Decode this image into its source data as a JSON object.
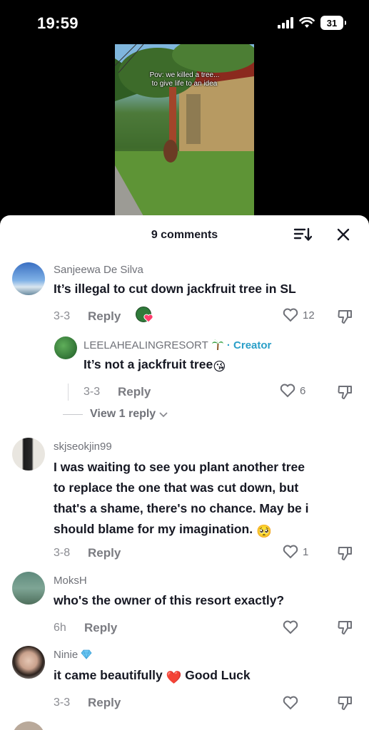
{
  "status_bar": {
    "time": "19:59",
    "battery": "31"
  },
  "video": {
    "caption_line1": "Pov: we killed a tree...",
    "caption_line2": "to give life to an idea"
  },
  "sheet": {
    "title": "9 comments"
  },
  "comments": [
    {
      "username": "Sanjeewa De Silva",
      "text": "It’s illegal to cut down jackfruit tree in SL",
      "date": "3-3",
      "reply_label": "Reply",
      "likes": "12"
    },
    {
      "username": "LEELAHEALINGRESORT",
      "creator_label": "· Creator",
      "text": "It’s not a jackfruit tree",
      "date": "3-3",
      "reply_label": "Reply",
      "likes": "6",
      "emoji": "😘"
    },
    {
      "view_replies": "View 1 reply"
    },
    {
      "username": "skjseokjin99",
      "text_lines": [
        "I was waiting to see you plant another tree",
        "to replace the one that was cut down, but",
        "that's a shame, there's no chance. May be i",
        "should blame for my imagination."
      ],
      "date": "3-8",
      "reply_label": "Reply",
      "likes": "1",
      "emoji": "🥺"
    },
    {
      "username": "MoksH",
      "text": "who's the owner of this resort exactly?",
      "date": "6h",
      "reply_label": "Reply",
      "likes": ""
    },
    {
      "username": "Ninie",
      "text_before": "it came beautifully",
      "text_after": "Good Luck",
      "date": "3-3",
      "reply_label": "Reply",
      "likes": "",
      "emoji": "❤️"
    }
  ],
  "colors": {
    "creator": "#2a9fc8",
    "text": "#161823",
    "muted": "#8a8b91"
  }
}
